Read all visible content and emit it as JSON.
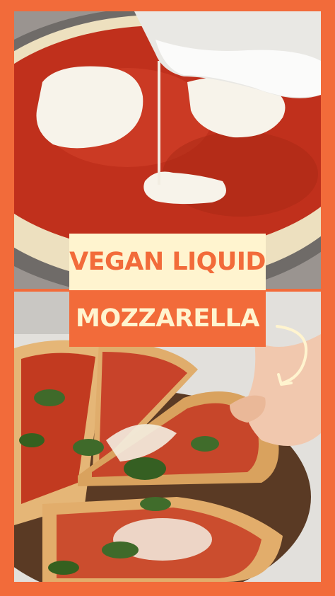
{
  "title": {
    "line1": "VEGAN LIQUID",
    "line2": "MOZZARELLA"
  },
  "colors": {
    "border": "#f26b3a",
    "title_bg_light": "#fff4cf",
    "title_text_orange": "#f26b3a",
    "sauce": "#c8321e",
    "cheese": "#f5f1e8"
  },
  "icons": {
    "arrow": "curved-arrow-icon"
  }
}
